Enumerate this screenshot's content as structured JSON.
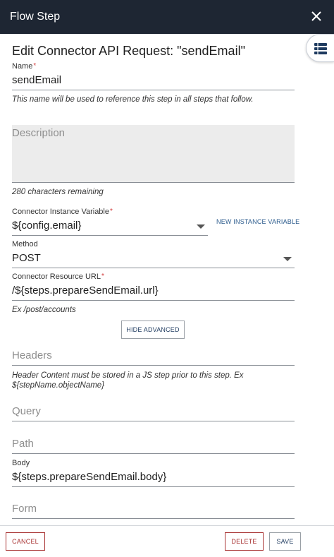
{
  "header": {
    "title": "Flow Step"
  },
  "page": {
    "title": "Edit Connector API Request: \"sendEmail\""
  },
  "name": {
    "label": "Name",
    "required": "*",
    "value": "sendEmail",
    "hint": "This name will be used to reference this step in all steps that follow."
  },
  "description": {
    "placeholder": "Description",
    "remaining": "280 characters remaining"
  },
  "connector": {
    "label": "Connector Instance Variable",
    "required": "*",
    "value": "${config.email}",
    "new_instance": "NEW INSTANCE VARIABLE"
  },
  "method": {
    "label": "Method",
    "value": "POST"
  },
  "resource_url": {
    "label": "Connector Resource URL",
    "required": "*",
    "value": "/${steps.prepareSendEmail.url}",
    "hint": "Ex /post/accounts"
  },
  "advanced": {
    "hide_label": "HIDE ADVANCED"
  },
  "headers": {
    "placeholder": "Headers",
    "hint_line1": "Header Content must be stored in a JS step prior to this step. Ex",
    "hint_line2": "${stepName.objectName}"
  },
  "query": {
    "placeholder": "Query"
  },
  "path": {
    "placeholder": "Path"
  },
  "body": {
    "label": "Body",
    "value": "${steps.prepareSendEmail.body}"
  },
  "form": {
    "placeholder": "Form"
  },
  "footer": {
    "cancel": "CANCEL",
    "delete": "DELETE",
    "save": "SAVE"
  },
  "icons": {
    "close": "close-icon",
    "side": "table-list-icon",
    "dropdown": "chevron-down-icon"
  },
  "colors": {
    "header_bg": "#1e2633",
    "required": "#d13b3b",
    "link": "#2a5a8c",
    "danger": "#a83232"
  }
}
